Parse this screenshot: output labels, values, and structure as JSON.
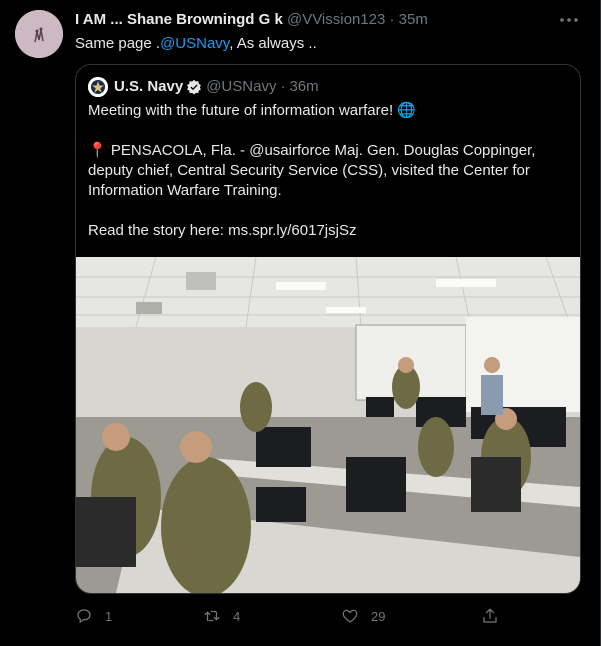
{
  "tweet": {
    "author_name": "I AM ... Shane Browningd G k",
    "author_handle": "@VVission123",
    "time": "35m",
    "text_before": "Same page .",
    "mention": "@USNavy",
    "text_after": ", As always .."
  },
  "quote": {
    "author_name": "U.S. Navy",
    "author_handle": "@USNavy",
    "time": "36m",
    "line1": "Meeting with the future of information warfare! 🌐",
    "para2_pin": "📍",
    "para2": " PENSACOLA, Fla. - @usairforce Maj. Gen. Douglas Coppinger, deputy chief, Central Security Service (CSS), visited the Center for Information Warfare Training.",
    "read_prefix": "Read the story here: ",
    "read_link": "ms.spr.ly/6017jsjSz"
  },
  "actions": {
    "reply_count": "1",
    "retweet_count": "4",
    "like_count": "29"
  },
  "icons": [
    "more-icon",
    "verified-badge-icon",
    "reply-icon",
    "retweet-icon",
    "like-icon",
    "share-icon"
  ],
  "colors": {
    "accent": "#1d9bf0",
    "muted": "#71767b",
    "background": "#000000"
  }
}
